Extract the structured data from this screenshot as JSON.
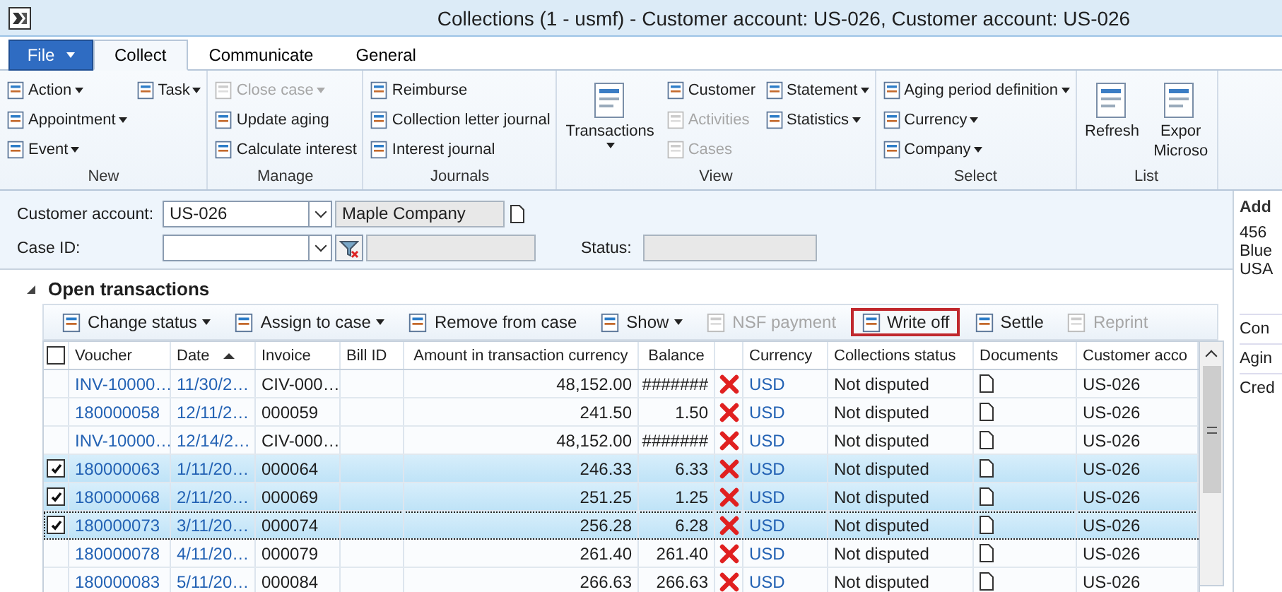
{
  "window": {
    "title": "Collections (1 - usmf) - Customer account: US-026, Customer account: US-026"
  },
  "file_button": {
    "label": "File"
  },
  "tabs": [
    {
      "label": "Collect",
      "selected": true
    },
    {
      "label": "Communicate",
      "selected": false
    },
    {
      "label": "General",
      "selected": false
    }
  ],
  "ribbon_groups": [
    {
      "label": "New",
      "columns": [
        [
          {
            "kind": "small",
            "label": "Action",
            "dropdown": true,
            "disabled": false
          },
          {
            "kind": "small",
            "label": "Appointment",
            "dropdown": true,
            "disabled": false
          },
          {
            "kind": "small",
            "label": "Event",
            "dropdown": true,
            "disabled": false
          }
        ],
        [
          {
            "kind": "small",
            "label": "Task",
            "dropdown": true,
            "disabled": false
          }
        ]
      ]
    },
    {
      "label": "Manage",
      "columns": [
        [
          {
            "kind": "small",
            "label": "Close case",
            "dropdown": true,
            "disabled": true
          },
          {
            "kind": "small",
            "label": "Update aging",
            "dropdown": false,
            "disabled": false
          },
          {
            "kind": "small",
            "label": "Calculate interest",
            "dropdown": false,
            "disabled": false
          }
        ]
      ]
    },
    {
      "label": "Journals",
      "columns": [
        [
          {
            "kind": "small",
            "label": "Reimburse",
            "dropdown": false,
            "disabled": false
          },
          {
            "kind": "small",
            "label": "Collection letter journal",
            "dropdown": false,
            "disabled": false
          },
          {
            "kind": "small",
            "label": "Interest journal",
            "dropdown": false,
            "disabled": false
          }
        ]
      ]
    },
    {
      "label": "View",
      "columns": [
        [
          {
            "kind": "large",
            "lines": [
              "Transactions"
            ],
            "dropdown": true,
            "disabled": false
          }
        ],
        [
          {
            "kind": "small",
            "label": "Customer",
            "dropdown": false,
            "disabled": false
          },
          {
            "kind": "small",
            "label": "Activities",
            "dropdown": false,
            "disabled": true
          },
          {
            "kind": "small",
            "label": "Cases",
            "dropdown": false,
            "disabled": true
          }
        ],
        [
          {
            "kind": "small",
            "label": "Statement",
            "dropdown": true,
            "disabled": false
          },
          {
            "kind": "small",
            "label": "Statistics",
            "dropdown": true,
            "disabled": false
          }
        ]
      ]
    },
    {
      "label": "Select",
      "columns": [
        [
          {
            "kind": "small",
            "label": "Aging period definition",
            "dropdown": true,
            "disabled": false
          },
          {
            "kind": "small",
            "label": "Currency",
            "dropdown": true,
            "disabled": false
          },
          {
            "kind": "small",
            "label": "Company",
            "dropdown": true,
            "disabled": false
          }
        ]
      ]
    },
    {
      "label": "List",
      "columns": [
        [
          {
            "kind": "large",
            "lines": [
              "Refresh"
            ],
            "dropdown": false,
            "disabled": false
          }
        ],
        [
          {
            "kind": "large",
            "lines": [
              "Expor",
              "Microso"
            ],
            "dropdown": false,
            "disabled": false
          }
        ]
      ]
    }
  ],
  "form": {
    "customer_account": {
      "label": "Customer account:",
      "value": "US-026",
      "name": "Maple Company"
    },
    "case_id": {
      "label": "Case ID:"
    },
    "status": {
      "label": "Status:"
    }
  },
  "section": {
    "title": "Open transactions",
    "expanded": true
  },
  "toolbar": [
    {
      "label": "Change status",
      "dropdown": true,
      "disabled": false,
      "focused": false
    },
    {
      "label": "Assign to case",
      "dropdown": true,
      "disabled": false,
      "focused": false
    },
    {
      "label": "Remove from case",
      "dropdown": false,
      "disabled": false,
      "focused": false
    },
    {
      "label": "Show",
      "dropdown": true,
      "disabled": false,
      "focused": false
    },
    {
      "label": "NSF payment",
      "dropdown": false,
      "disabled": true,
      "focused": false
    },
    {
      "label": "Write off",
      "dropdown": false,
      "disabled": false,
      "focused": true
    },
    {
      "label": "Settle",
      "dropdown": false,
      "disabled": false,
      "focused": false
    },
    {
      "label": "Reprint",
      "dropdown": false,
      "disabled": true,
      "focused": false
    }
  ],
  "table": {
    "columns": [
      {
        "kind": "checkbox",
        "checked": false,
        "sorted": false
      },
      {
        "kind": "text",
        "label": "Voucher",
        "sorted": false
      },
      {
        "kind": "text",
        "label": "Date",
        "sorted": true
      },
      {
        "kind": "text",
        "label": "Invoice",
        "sorted": false
      },
      {
        "kind": "text",
        "label": "Bill ID",
        "sorted": false
      },
      {
        "kind": "text",
        "label": "Amount in transaction currency",
        "sorted": false
      },
      {
        "kind": "text",
        "label": "Balance",
        "sorted": false
      },
      {
        "kind": "icon",
        "sorted": false
      },
      {
        "kind": "text",
        "label": "Currency",
        "sorted": false
      },
      {
        "kind": "text",
        "label": "Collections status",
        "sorted": false
      },
      {
        "kind": "text",
        "label": "Documents",
        "sorted": false
      },
      {
        "kind": "text",
        "label": "Customer acco",
        "sorted": false
      }
    ],
    "rows": [
      {
        "checked": false,
        "selected": false,
        "focused": false,
        "voucher": "INV-10000…",
        "date": "11/30/2…",
        "invoice": "CIV-000…",
        "amount": "48,152.00",
        "balance": "#######",
        "currency": "USD",
        "status": "Not disputed",
        "customer_account": "US-026"
      },
      {
        "checked": false,
        "selected": false,
        "focused": false,
        "voucher": "180000058",
        "date": "12/11/2…",
        "invoice": "000059",
        "amount": "241.50",
        "balance": "1.50",
        "currency": "USD",
        "status": "Not disputed",
        "customer_account": "US-026"
      },
      {
        "checked": false,
        "selected": false,
        "focused": false,
        "voucher": "INV-10000…",
        "date": "12/14/2…",
        "invoice": "CIV-000…",
        "amount": "48,152.00",
        "balance": "#######",
        "currency": "USD",
        "status": "Not disputed",
        "customer_account": "US-026"
      },
      {
        "checked": true,
        "selected": true,
        "focused": false,
        "voucher": "180000063",
        "date": "1/11/20…",
        "invoice": "000064",
        "amount": "246.33",
        "balance": "6.33",
        "currency": "USD",
        "status": "Not disputed",
        "customer_account": "US-026"
      },
      {
        "checked": true,
        "selected": true,
        "focused": false,
        "voucher": "180000068",
        "date": "2/11/20…",
        "invoice": "000069",
        "amount": "251.25",
        "balance": "1.25",
        "currency": "USD",
        "status": "Not disputed",
        "customer_account": "US-026"
      },
      {
        "checked": true,
        "selected": true,
        "focused": true,
        "voucher": "180000073",
        "date": "3/11/20…",
        "invoice": "000074",
        "amount": "256.28",
        "balance": "6.28",
        "currency": "USD",
        "status": "Not disputed",
        "customer_account": "US-026"
      },
      {
        "checked": false,
        "selected": false,
        "focused": false,
        "voucher": "180000078",
        "date": "4/11/20…",
        "invoice": "000079",
        "amount": "261.40",
        "balance": "261.40",
        "currency": "USD",
        "status": "Not disputed",
        "customer_account": "US-026"
      },
      {
        "checked": false,
        "selected": false,
        "focused": false,
        "voucher": "180000083",
        "date": "5/11/20…",
        "invoice": "000084",
        "amount": "266.63",
        "balance": "266.63",
        "currency": "USD",
        "status": "Not disputed",
        "customer_account": "US-026"
      }
    ]
  },
  "side_panel": {
    "heading": "Add",
    "address_lines": [
      "456",
      "Blue",
      "USA"
    ],
    "links": [
      "Con",
      "Agin",
      "Cred"
    ]
  }
}
